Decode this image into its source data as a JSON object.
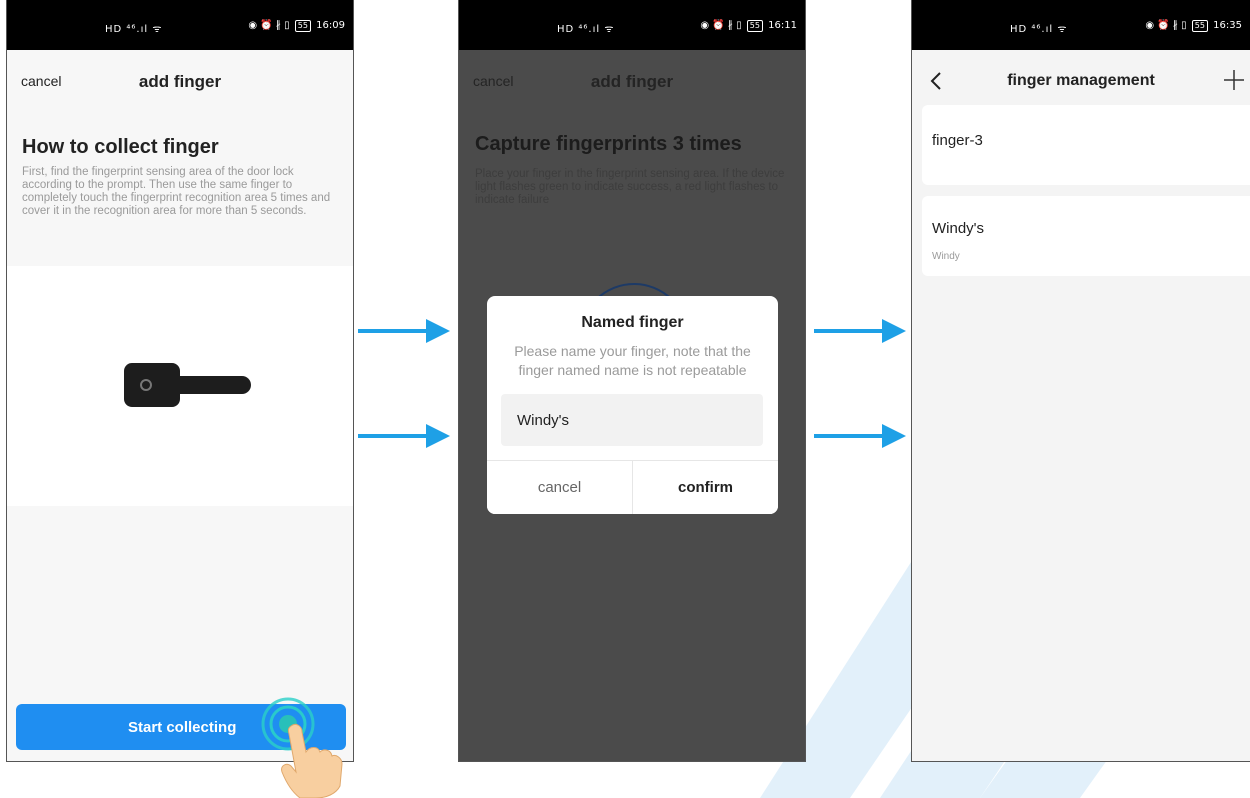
{
  "status_bar": {
    "left_icons": "HD ⁴⁶.ıl ᯤ",
    "right_icons": "◉ ⏰ ∦ ▯",
    "battery": "55",
    "times": [
      "16:09",
      "16:11",
      "16:35"
    ]
  },
  "screen1": {
    "nav": {
      "cancel_label": "cancel",
      "title": "add finger"
    },
    "heading": "How to collect finger",
    "description": "First, find the fingerprint sensing area of the door lock according to the prompt. Then use the same finger to completely touch the fingerprint recognition area 5 times and cover it in the recognition area for more than 5 seconds.",
    "image_icon": "door-handle-icon",
    "start_button_label": "Start collecting"
  },
  "screen2": {
    "nav": {
      "cancel_label": "cancel",
      "title": "add finger"
    },
    "heading": "Capture fingerprints 3 times",
    "description": "Place your finger in the fingerprint sensing area. If the device light flashes green to indicate success, a red light flashes to indicate failure",
    "dialog": {
      "title": "Named finger",
      "message": "Please name your finger, note that the finger named name is not repeatable",
      "input_value": "Windy's",
      "cancel_label": "cancel",
      "confirm_label": "confirm"
    }
  },
  "screen3": {
    "nav": {
      "back_icon": "chevron-left-icon",
      "title": "finger management",
      "add_icon": "plus-icon"
    },
    "fingers": [
      {
        "name": "finger-3",
        "subtitle": ""
      },
      {
        "name": "Windy's",
        "subtitle": "Windy"
      }
    ]
  },
  "colors": {
    "accent": "#1f8ef1",
    "arrow": "#1ea0e6",
    "overlay": "#4b4b4b",
    "watermark": "#dbeefa"
  }
}
